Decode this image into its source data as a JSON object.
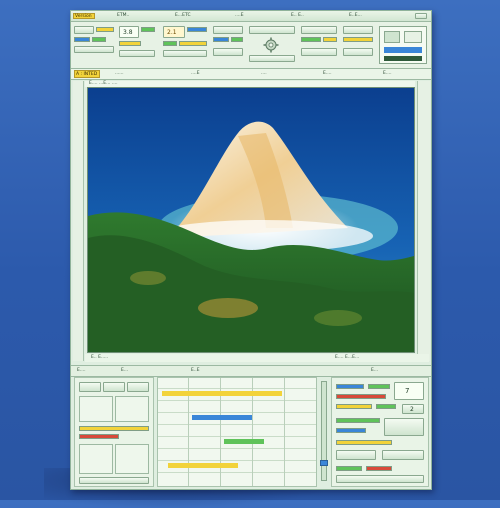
{
  "app": {
    "tag": "Version",
    "title_fragments": [
      "ETM..",
      "E...ETC",
      "....E",
      "E.. E..",
      "E..E..."
    ]
  },
  "toolbar": {
    "value_readout": "3.8",
    "value_readout_2": "2.1",
    "mode_tag": "A : INTED",
    "row2_items": [
      "......",
      "....E",
      "....",
      "E....",
      "E...."
    ]
  },
  "viewport": {
    "caption": "E.... ...E... ....",
    "status_left": "E.. E.....",
    "status_right": "E.... E...E..."
  },
  "bottom_panel": {
    "header_items": [
      "E....",
      "E...",
      "E..E",
      "E..."
    ],
    "right_readout": "7",
    "right_value": "2"
  },
  "colors": {
    "accent_yellow": "#f2d33a",
    "accent_green": "#5fc35a",
    "accent_blue": "#3a86d8",
    "accent_red": "#d84a3a",
    "panel_bg": "#dfeee0"
  }
}
